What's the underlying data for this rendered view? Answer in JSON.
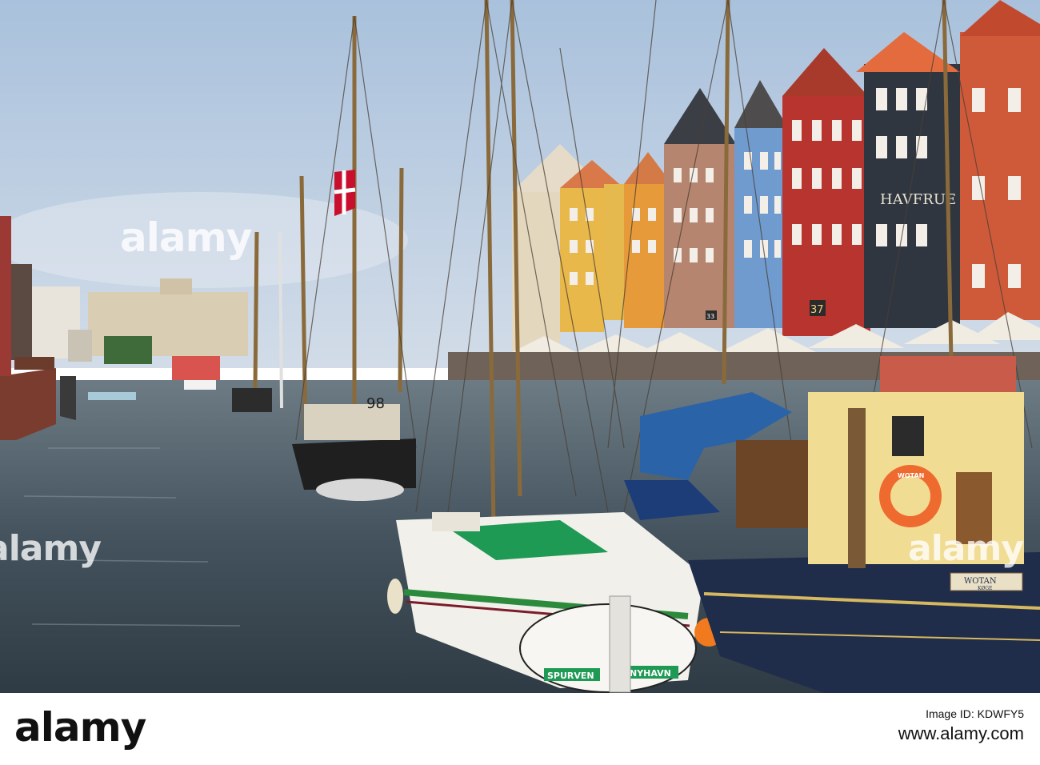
{
  "watermark": {
    "brand": "alamy",
    "side_left": "alamy",
    "side_right": "alamy"
  },
  "boat_labels": {
    "stern_name": "SPURVEN",
    "stern_port": "NYHAVN",
    "sign_number": "37",
    "sign_small": "33",
    "hull_number": "98",
    "facade_text": "HAVFRUE",
    "nameplate": "WOTAN",
    "nameplate_sub": "KØGE",
    "lifebuoy": "WOTAN"
  },
  "footer": {
    "logo": "alamy",
    "image_id_label": "Image ID: KDWFY5",
    "site": "www.alamy.com"
  },
  "colors": {
    "sky": "#aac3dd",
    "water": "#4a5a66",
    "footer_bg": "#ffffff",
    "footer_text": "#111111"
  }
}
